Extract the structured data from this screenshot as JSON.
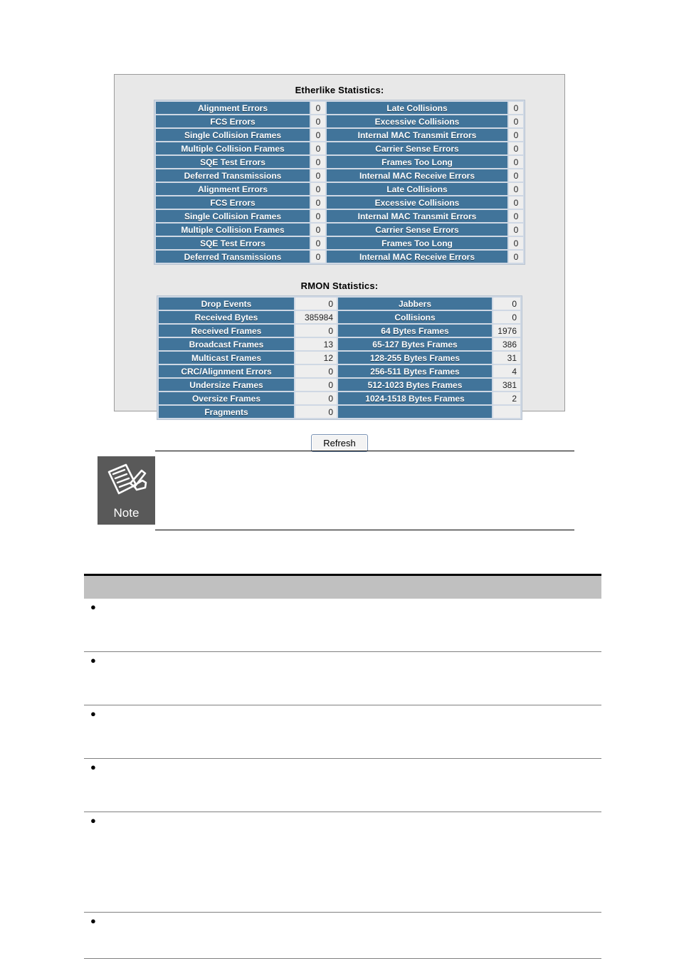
{
  "stats_panel": {
    "etherlike": {
      "title": "Etherlike Statistics:",
      "rows": [
        {
          "left_label": "Alignment Errors",
          "left_value": "0",
          "right_label": "Late Collisions",
          "right_value": "0"
        },
        {
          "left_label": "FCS Errors",
          "left_value": "0",
          "right_label": "Excessive Collisions",
          "right_value": "0"
        },
        {
          "left_label": "Single Collision Frames",
          "left_value": "0",
          "right_label": "Internal MAC Transmit Errors",
          "right_value": "0"
        },
        {
          "left_label": "Multiple Collision Frames",
          "left_value": "0",
          "right_label": "Carrier Sense Errors",
          "right_value": "0"
        },
        {
          "left_label": "SQE Test Errors",
          "left_value": "0",
          "right_label": "Frames Too Long",
          "right_value": "0"
        },
        {
          "left_label": "Deferred Transmissions",
          "left_value": "0",
          "right_label": "Internal MAC Receive Errors",
          "right_value": "0"
        }
      ]
    },
    "rmon": {
      "title": "RMON Statistics:",
      "rows": [
        {
          "left_label": "Drop Events",
          "left_value": "0",
          "right_label": "Jabbers",
          "right_value": "0"
        },
        {
          "left_label": "Received Bytes",
          "left_value": "385984",
          "right_label": "Collisions",
          "right_value": "0"
        },
        {
          "left_label": "Received Frames",
          "left_value": "0",
          "right_label": "64 Bytes Frames",
          "right_value": "1976"
        },
        {
          "left_label": "Broadcast Frames",
          "left_value": "13",
          "right_label": "65-127 Bytes Frames",
          "right_value": "386"
        },
        {
          "left_label": "Multicast Frames",
          "left_value": "12",
          "right_label": "128-255 Bytes Frames",
          "right_value": "31"
        },
        {
          "left_label": "CRC/Alignment Errors",
          "left_value": "0",
          "right_label": "256-511 Bytes Frames",
          "right_value": "4"
        },
        {
          "left_label": "Undersize Frames",
          "left_value": "0",
          "right_label": "512-1023 Bytes Frames",
          "right_value": "381"
        },
        {
          "left_label": "Oversize Frames",
          "left_value": "0",
          "right_label": "1024-1518 Bytes Frames",
          "right_value": "2"
        },
        {
          "left_label": "Fragments",
          "left_value": "0",
          "right_label": "",
          "right_value": ""
        }
      ]
    },
    "refresh_label": "Refresh"
  },
  "note": {
    "icon_label": "Note",
    "text": ""
  },
  "description_table": {
    "header": "",
    "rows": [
      {
        "text": ""
      },
      {
        "text": ""
      },
      {
        "text": ""
      },
      {
        "text": ""
      },
      {
        "text": ""
      },
      {
        "text": ""
      }
    ]
  },
  "colors": {
    "panel_background": "#e8e8e8",
    "panel_border": "#9b9b9b",
    "header_cell": "#41749a",
    "value_cell": "#eeeeee",
    "table_gap": "#cfd8e4",
    "note_box": "#595959",
    "desc_header": "#c0c0c0",
    "rule": "#000000"
  }
}
